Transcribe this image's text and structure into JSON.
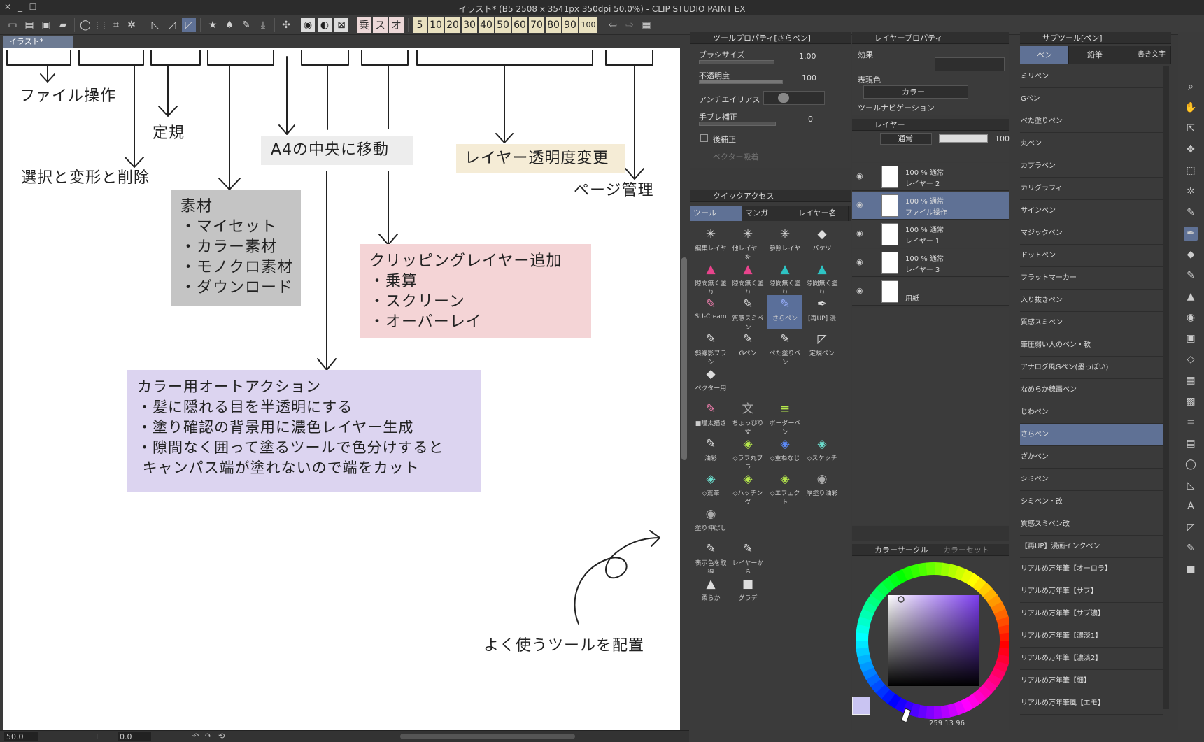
{
  "window": {
    "title": "イラスト* (B5 2508 x 3541px 350dpi 50.0%) - CLIP STUDIO PAINT EX"
  },
  "toolbar": {
    "kanji_buttons": [
      "乗",
      "ス",
      "オ"
    ],
    "opacity_buttons": [
      "5",
      "10",
      "20",
      "30",
      "40",
      "50",
      "60",
      "70",
      "80",
      "90",
      "100"
    ]
  },
  "document_tab": {
    "label": "イラスト*"
  },
  "canvas": {
    "labels": {
      "file_ops": "ファイル操作",
      "ruler": "定規",
      "select_transform": "選択と変形と削除",
      "move_center": "A4の中央に移動",
      "layer_opacity": "レイヤー透明度変更",
      "page_manage": "ページ管理",
      "frequent_tools": "よく使うツールを配置"
    },
    "materials_box": {
      "color": "#c4c4c4",
      "lines": [
        "素材",
        "・マイセット",
        "・カラー素材",
        "・モノクロ素材",
        "・ダウンロード"
      ]
    },
    "clipping_box": {
      "color": "#f4d4d6",
      "lines": [
        "クリッピングレイヤー追加",
        "・乗算",
        "・スクリーン",
        "・オーバーレイ"
      ]
    },
    "autoaction_box": {
      "color": "#dcd4f0",
      "lines": [
        "カラー用オートアクション",
        "・髪に隠れる目を半透明にする",
        "・塗り確認の背景用に濃色レイヤー生成",
        "・隙間なく囲って塗るツールで色分けすると",
        " キャンパス端が塗れないので端をカット"
      ]
    },
    "move_center_box_color": "#ededed",
    "layer_opacity_box_color": "#f5ecd6"
  },
  "statusbar": {
    "zoom": "50.0",
    "angle": "0.0"
  },
  "tool_property": {
    "header": "ツールプロパティ[さらペン]",
    "brush_size_label": "ブラシサイズ",
    "brush_size_value": "1.00",
    "opacity_label": "不透明度",
    "opacity_value": "100",
    "antialias_label": "アンチエイリアス",
    "stabilize_label": "手ブレ補正",
    "stabilize_value": "0",
    "post_correct_label": "後補正",
    "vector_label": "ベクター吸着"
  },
  "layer_property": {
    "header": "レイヤープロパティ",
    "effect_label": "効果",
    "expression_label": "表現色",
    "expression_value": "カラー",
    "navi_label": "ツールナビゲーション"
  },
  "layer_panel": {
    "header": "レイヤー",
    "blend_mode": "通常",
    "opacity": "100",
    "layers": [
      {
        "line1": "100 % 通常",
        "line2": "レイヤー 2",
        "selected": false
      },
      {
        "line1": "100 % 通常",
        "line2": "ファイル操作",
        "selected": true
      },
      {
        "line1": "100 % 通常",
        "line2": "レイヤー 1",
        "selected": false
      },
      {
        "line1": "100 % 通常",
        "line2": "レイヤー 3",
        "selected": false
      },
      {
        "line1": "",
        "line2": "用紙",
        "selected": false
      }
    ]
  },
  "quick_access": {
    "header": "クイックアクセス",
    "tabs": [
      "ツール",
      "マンガ",
      "レイヤー名"
    ],
    "items": [
      {
        "label": "編集レイヤー",
        "icon": "✳",
        "color": "#ddd"
      },
      {
        "label": "他レイヤーを",
        "icon": "✳",
        "color": "#ddd"
      },
      {
        "label": "参照レイヤー",
        "icon": "✳",
        "color": "#ddd"
      },
      {
        "label": "バケツ",
        "icon": "◆",
        "color": "#ddd"
      },
      {
        "label": "隙間無く塗り",
        "icon": "▲",
        "color": "#e8448c"
      },
      {
        "label": "隙間無く塗り",
        "icon": "▲",
        "color": "#e8448c"
      },
      {
        "label": "隙間無く塗り",
        "icon": "▲",
        "color": "#2ec4c4"
      },
      {
        "label": "隙間無く塗り",
        "icon": "▲",
        "color": "#2ec4c4"
      },
      {
        "label": "SU-Cream",
        "icon": "✎",
        "color": "#f07fae"
      },
      {
        "label": "質感スミペン",
        "icon": "✎",
        "color": "#ddd"
      },
      {
        "label": "さらペン",
        "icon": "✎",
        "color": "#9ab0ff",
        "selected": true
      },
      {
        "label": "[再UP] 漫",
        "icon": "✒",
        "color": "#ddd"
      },
      {
        "label": "斜線影ブラシ",
        "icon": "✎",
        "color": "#ddd"
      },
      {
        "label": "Gペン",
        "icon": "✎",
        "color": "#ddd"
      },
      {
        "label": "べた塗りペン",
        "icon": "✎",
        "color": "#ddd"
      },
      {
        "label": "定規ペン",
        "icon": "◸",
        "color": "#ddd"
      },
      {
        "label": "ベクター用",
        "icon": "◆",
        "color": "#ddd"
      },
      {
        "label": "",
        "icon": "",
        "color": "#ddd"
      },
      {
        "label": "",
        "icon": "",
        "color": "#ddd"
      },
      {
        "label": "",
        "icon": "",
        "color": "#ddd"
      },
      {
        "label": "■瞳太描き",
        "icon": "✎",
        "color": "#f07fae"
      },
      {
        "label": "ちょっぴり文",
        "icon": "文",
        "color": "#aaa"
      },
      {
        "label": "ボーダーペン",
        "icon": "≡",
        "color": "#b6e84c"
      },
      {
        "label": "",
        "icon": "",
        "color": "#ddd"
      },
      {
        "label": "油彩",
        "icon": "✎",
        "color": "#ddd"
      },
      {
        "label": "◇ラフ丸ブラ",
        "icon": "◈",
        "color": "#b6e84c"
      },
      {
        "label": "◇重ねなじ",
        "icon": "◈",
        "color": "#5c8cff"
      },
      {
        "label": "◇スケッチ",
        "icon": "◈",
        "color": "#6ce0d0"
      },
      {
        "label": "◇荒筆",
        "icon": "◈",
        "color": "#6ce0d0"
      },
      {
        "label": "◇ハッチング",
        "icon": "◈",
        "color": "#b6e84c"
      },
      {
        "label": "◇エフェクト",
        "icon": "◈",
        "color": "#b6e84c"
      },
      {
        "label": "厚塗り油彩",
        "icon": "◉",
        "color": "#aaa"
      },
      {
        "label": "塗り伸ばし",
        "icon": "◉",
        "color": "#aaa"
      },
      {
        "label": "",
        "icon": "",
        "color": "#ddd"
      },
      {
        "label": "",
        "icon": "",
        "color": "#ddd"
      },
      {
        "label": "",
        "icon": "",
        "color": "#ddd"
      },
      {
        "label": "表示色を取得",
        "icon": "✎",
        "color": "#ddd"
      },
      {
        "label": "レイヤーから",
        "icon": "✎",
        "color": "#ddd"
      },
      {
        "label": "",
        "icon": "",
        "color": "#ddd"
      },
      {
        "label": "",
        "icon": "",
        "color": "#ddd"
      },
      {
        "label": "柔らか",
        "icon": "▲",
        "color": "#ddd"
      },
      {
        "label": "グラデ",
        "icon": "■",
        "color": "#ddd"
      }
    ]
  },
  "color_circle": {
    "header": "カラーサークル",
    "tab2": "カラーセット",
    "main_color": "#c9c4f2",
    "hue_color": "#7c3cf0",
    "readout": "259",
    "readout2": "13",
    "readout3": "96"
  },
  "sub_tool": {
    "header": "サブツール[ペン]",
    "tabs": [
      "ペン",
      "鉛筆",
      "書き文字"
    ],
    "items": [
      "ミリペン",
      "Gペン",
      "べた塗りペン",
      "丸ペン",
      "カブラペン",
      "カリグラフィ",
      "サインペン",
      "マジックペン",
      "ドットペン",
      "フラットマーカー",
      "入り抜きペン",
      "質感スミペン",
      "筆圧弱い人のペン・軟",
      "アナログ風Gペン(墨っぽい)",
      "なめらか線画ペン",
      "じわペン",
      "さらペン",
      "ざかペン",
      "シミペン",
      "シミペン・改",
      "質感スミペン改",
      "【再UP】漫画インクペン",
      "リアルめ万年筆【オーロラ】",
      "リアルめ万年筆【サブ】",
      "リアルめ万年筆【サブ濃】",
      "リアルめ万年筆【濃淡1】",
      "リアルめ万年筆【濃淡2】",
      "リアルめ万年筆【細】",
      "リアルめ万年筆風【エモ】"
    ],
    "selected": "さらペン"
  }
}
